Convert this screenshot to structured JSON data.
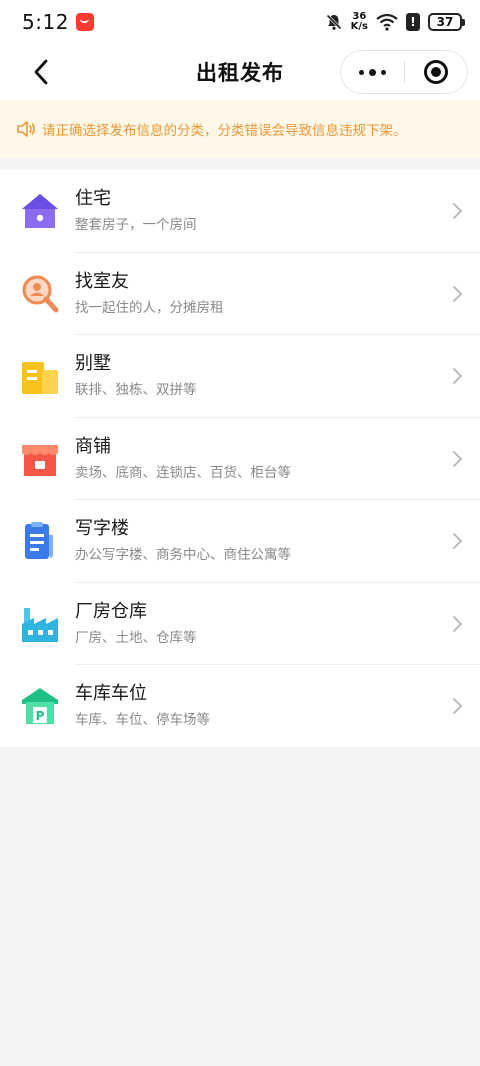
{
  "status_bar": {
    "time": "5:12",
    "net_speed_value": "36",
    "net_speed_unit": "K/s",
    "battery": "37"
  },
  "nav": {
    "title": "出租发布"
  },
  "notice": {
    "text": "请正确选择发布信息的分类，分类错误会导致信息违规下架。",
    "color": "#e8983a"
  },
  "categories": [
    {
      "title": "住宅",
      "subtitle": "整套房子，一个房间",
      "icon": "house-icon"
    },
    {
      "title": "找室友",
      "subtitle": "找一起住的人，分摊房租",
      "icon": "search-person-icon"
    },
    {
      "title": "别墅",
      "subtitle": "联排、独栋、双拼等",
      "icon": "villa-icon"
    },
    {
      "title": "商铺",
      "subtitle": "卖场、底商、连锁店、百货、柜台等",
      "icon": "shop-icon"
    },
    {
      "title": "写字楼",
      "subtitle": "办公写字楼、商务中心、商住公寓等",
      "icon": "office-doc-icon"
    },
    {
      "title": "厂房仓库",
      "subtitle": "厂房、土地、仓库等",
      "icon": "factory-icon"
    },
    {
      "title": "车库车位",
      "subtitle": "车库、车位、停车场等",
      "icon": "garage-icon"
    }
  ]
}
